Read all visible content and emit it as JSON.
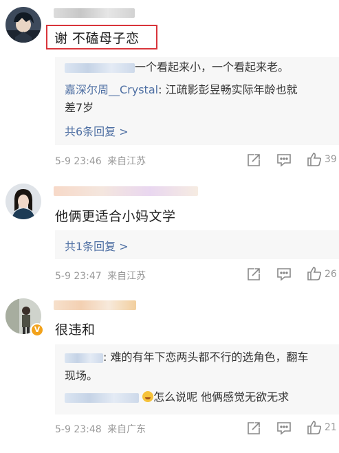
{
  "comments": [
    {
      "text": "谢  不磕母子恋",
      "replies_preview": [
        {
          "author": "",
          "text": "一个看起来小，一个看起来老。"
        },
        {
          "author": "嘉深尔周__Crystal",
          "text": ": 江疏影彭昱畅实际年龄也就",
          "text_cont": "差7岁"
        }
      ],
      "more_replies": "共6条回复 >",
      "timestamp": "5-9 23:46",
      "location": "来自江苏",
      "like_count": "39"
    },
    {
      "text": "他俩更适合小妈文学",
      "more_replies": "共1条回复 >",
      "timestamp": "5-9 23:47",
      "location": "来自江苏",
      "like_count": "26"
    },
    {
      "text": "很违和",
      "replies_preview": [
        {
          "author": "",
          "text": ": 难的有年下恋两头都不行的选角色，翻车",
          "text_cont": "现场。"
        },
        {
          "author": "",
          "text": "怎么说呢 他俩感觉无欲无求"
        }
      ],
      "timestamp": "5-9 23:48",
      "location": "来自广东",
      "like_count": "21"
    }
  ],
  "icons": [
    "share-icon",
    "comment-icon",
    "like-icon"
  ],
  "colors": {
    "link": "#4e6fa3",
    "highlight_box": "#d9343a",
    "reply_bg": "#f7f7f7",
    "meta": "#999999"
  }
}
